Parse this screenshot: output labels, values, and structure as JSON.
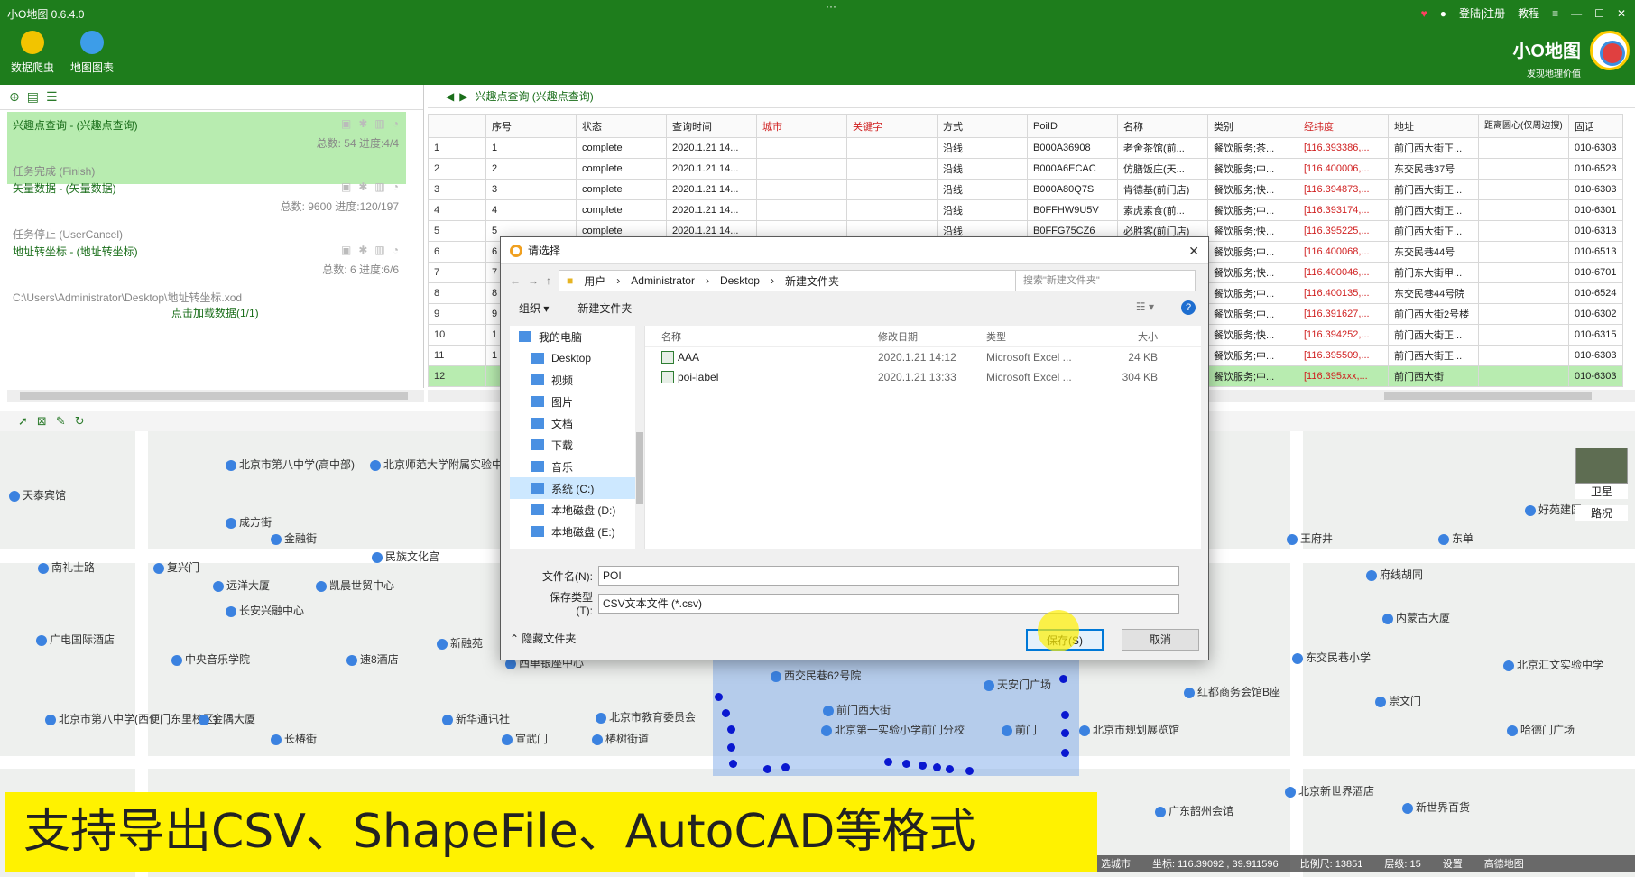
{
  "app": {
    "title": "小O地图 0.6.4.0",
    "grip": "···",
    "login": "登陆|注册",
    "tutorial": "教程"
  },
  "toolbar": {
    "crawler_label": "数据爬虫",
    "chart_label": "地图图表"
  },
  "brand": {
    "name": "小O地图",
    "slogan": "发现地理价值"
  },
  "tasks": [
    {
      "title": "兴趣点查询 - (兴趣点查询)",
      "stat": "总数: 54  进度:4/4",
      "state": "任务完成 (Finish)"
    },
    {
      "title": "矢量数据 - (矢量数据)",
      "stat": "总数: 9600  进度:120/197",
      "state": "任务停止 (UserCancel)"
    },
    {
      "title": "地址转坐标 - (地址转坐标)",
      "stat": "总数: 6  进度:6/6",
      "state": "C:\\Users\\Administrator\\Desktop\\地址转坐标.xod"
    }
  ],
  "task_load_link": "点击加载数据(1/1)",
  "grid": {
    "crumb": "兴趣点查询 (兴趣点查询)",
    "columns": [
      "序号",
      "状态",
      "查询时间",
      "城市",
      "关键字",
      "方式",
      "PoiID",
      "名称",
      "类别",
      "经纬度",
      "地址",
      "距离圆心(仅周边搜)",
      "固话"
    ],
    "rows": [
      [
        "1",
        "1",
        "complete",
        "2020.1.21 14...",
        "",
        "",
        "沿线",
        "B000A36908",
        "老舍茶馆(前...",
        "餐饮服务;茶...",
        "[116.393386,...",
        "前门西大街正...",
        "",
        "010-6303"
      ],
      [
        "2",
        "2",
        "complete",
        "2020.1.21 14...",
        "",
        "",
        "沿线",
        "B000A6ECAC",
        "仿膳饭庄(天...",
        "餐饮服务;中...",
        "[116.400006,...",
        "东交民巷37号",
        "",
        "010-6523"
      ],
      [
        "3",
        "3",
        "complete",
        "2020.1.21 14...",
        "",
        "",
        "沿线",
        "B000A80Q7S",
        "肯德基(前门店)",
        "餐饮服务;快...",
        "[116.394873,...",
        "前门西大街正...",
        "",
        "010-6303"
      ],
      [
        "4",
        "4",
        "complete",
        "2020.1.21 14...",
        "",
        "",
        "沿线",
        "B0FFHW9U5V",
        "素虎素食(前...",
        "餐饮服务;中...",
        "[116.393174,...",
        "前门西大街正...",
        "",
        "010-6301"
      ],
      [
        "5",
        "5",
        "complete",
        "2020.1.21 14...",
        "",
        "",
        "沿线",
        "B0FFG75CZ6",
        "必胜客(前门店)",
        "餐饮服务;快...",
        "[116.395225,...",
        "前门西大街正...",
        "",
        "010-6313"
      ],
      [
        "6",
        "6",
        "",
        "",
        "",
        "",
        "",
        "",
        "",
        "餐饮服务;中...",
        "[116.400068,...",
        "东交民巷44号",
        "",
        "010-6513"
      ],
      [
        "7",
        "7",
        "",
        "",
        "",
        "",
        "",
        "",
        "",
        "餐饮服务;快...",
        "[116.400046,...",
        "前门东大街甲...",
        "",
        "010-6701"
      ],
      [
        "8",
        "8",
        "",
        "",
        "",
        "",
        "",
        "",
        "",
        "餐饮服务;中...",
        "[116.400135,...",
        "东交民巷44号院",
        "",
        "010-6524"
      ],
      [
        "9",
        "9",
        "",
        "",
        "",
        "",
        "",
        "",
        "",
        "餐饮服务;中...",
        "[116.391627,...",
        "前门西大街2号楼",
        "",
        "010-6302"
      ],
      [
        "10",
        "1",
        "",
        "",
        "",
        "",
        "",
        "",
        "",
        "餐饮服务;快...",
        "[116.394252,...",
        "前门西大街正...",
        "",
        "010-6315"
      ],
      [
        "11",
        "1",
        "",
        "",
        "",
        "",
        "",
        "",
        "",
        "餐饮服务;中...",
        "[116.395509,...",
        "前门西大街正...",
        "",
        "010-6303"
      ],
      [
        "12",
        "",
        "",
        "",
        "",
        "",
        "",
        "",
        "",
        "餐饮服务;中...",
        "[116.395xxx,...",
        "前门西大街",
        "",
        "010-6303"
      ]
    ]
  },
  "dialog": {
    "title": "请选择",
    "path": [
      "用户",
      "Administrator",
      "Desktop",
      "新建文件夹"
    ],
    "search_placeholder": "搜索\"新建文件夹\"",
    "organize": "组织 ▾",
    "new_folder": "新建文件夹",
    "nav": [
      "我的电脑",
      "Desktop",
      "视频",
      "图片",
      "文档",
      "下载",
      "音乐",
      "系统 (C:)",
      "本地磁盘 (D:)",
      "本地磁盘 (E:)"
    ],
    "file_headers": [
      "名称",
      "修改日期",
      "类型",
      "大小"
    ],
    "files": [
      {
        "name": "AAA",
        "date": "2020.1.21 14:12",
        "type": "Microsoft Excel ...",
        "size": "24 KB"
      },
      {
        "name": "poi-label",
        "date": "2020.1.21 13:33",
        "type": "Microsoft Excel ...",
        "size": "304 KB"
      }
    ],
    "filename_label": "文件名(N):",
    "filename_value": "POI",
    "filetype_label": "保存类型(T):",
    "filetype_value": "CSV文本文件 (*.csv)",
    "hide_folders": "隐藏文件夹",
    "save": "保存(S)",
    "cancel": "取消"
  },
  "map": {
    "pois": [
      "北京市第八中学(高中部)",
      "北京师范大学附属实验中学",
      "天泰宾馆",
      "成方街",
      "金融街",
      "民族文化宫",
      "南礼士路",
      "复兴门",
      "远洋大厦",
      "凯晨世贸中心",
      "长安兴融中心",
      "广电国际酒店",
      "中央音乐学院",
      "新融苑",
      "速8酒店",
      "西单银座中心",
      "北京市第八中学(西便门东里校区)",
      "金隅大厦",
      "新华通讯社",
      "北京市教育委员会",
      "宣武门",
      "椿树街道",
      "长椿街",
      "西交民巷62号院",
      "前门西大街",
      "北京第一实验小学前门分校",
      "天安门广场",
      "前门",
      "北京市规划展览馆",
      "红都商务会馆B座",
      "东交民巷小学",
      "北京汇文实验中学",
      "崇文门",
      "王府井",
      "东单",
      "府线胡同",
      "内蒙古大厦",
      "好苑建国",
      "北京新世界酒店",
      "新世界百货",
      "广东韶州会馆",
      "哈德门广场"
    ],
    "satellite": "卫星",
    "roads": "路况",
    "status_coords": "坐标: 116.39092 , 39.911596",
    "status_scale": "比例尺: 13851",
    "status_level": "层级: 15",
    "status_settings": "设置",
    "status_provider": "高德地图",
    "status_select": "选城市"
  },
  "caption": "支持导出CSV、ShapeFile、AutoCAD等格式"
}
